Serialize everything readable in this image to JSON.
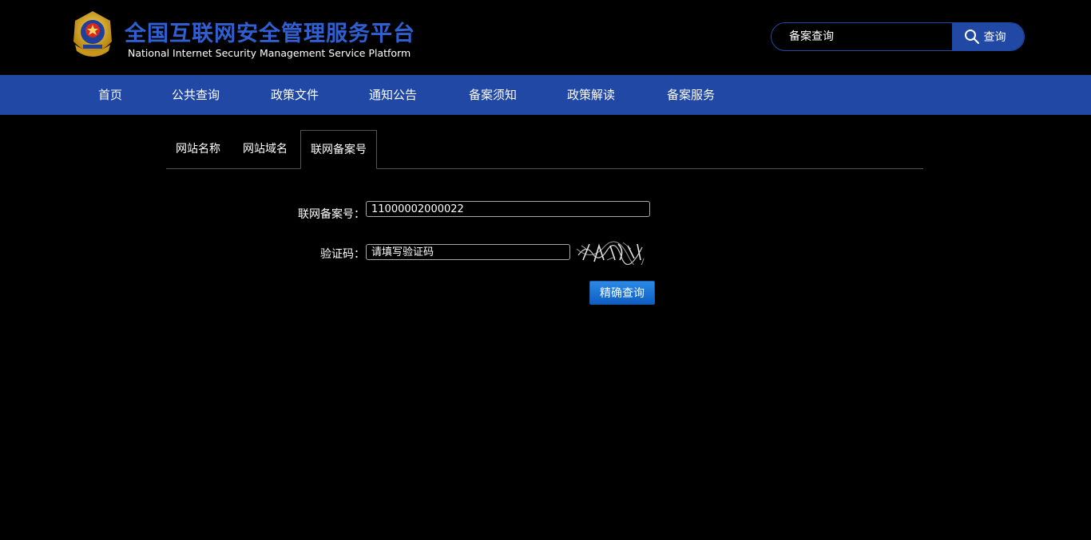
{
  "header": {
    "title_cn": "全国互联网安全管理服务平台",
    "title_en": "National Internet Security Management Service Platform",
    "logo_icon": "police-emblem-icon"
  },
  "search": {
    "placeholder": "备案查询",
    "button_label": "查询",
    "button_icon": "search-icon"
  },
  "nav": {
    "items": [
      {
        "label": "首页"
      },
      {
        "label": "公共查询"
      },
      {
        "label": "政策文件"
      },
      {
        "label": "通知公告"
      },
      {
        "label": "备案须知"
      },
      {
        "label": "政策解读"
      },
      {
        "label": "备案服务"
      }
    ]
  },
  "tabs": [
    {
      "label": "网站名称"
    },
    {
      "label": "网站域名"
    },
    {
      "label": "联网备案号"
    }
  ],
  "form": {
    "record_label": "联网备案号：",
    "record_value": "11000002000022",
    "captcha_label": "验证码：",
    "captcha_placeholder": "请填写验证码",
    "submit_label": "精确查询"
  },
  "colors": {
    "brand_blue": "#2048a4",
    "title_blue": "#2f5fd0",
    "button_blue": "#1a74d8"
  }
}
